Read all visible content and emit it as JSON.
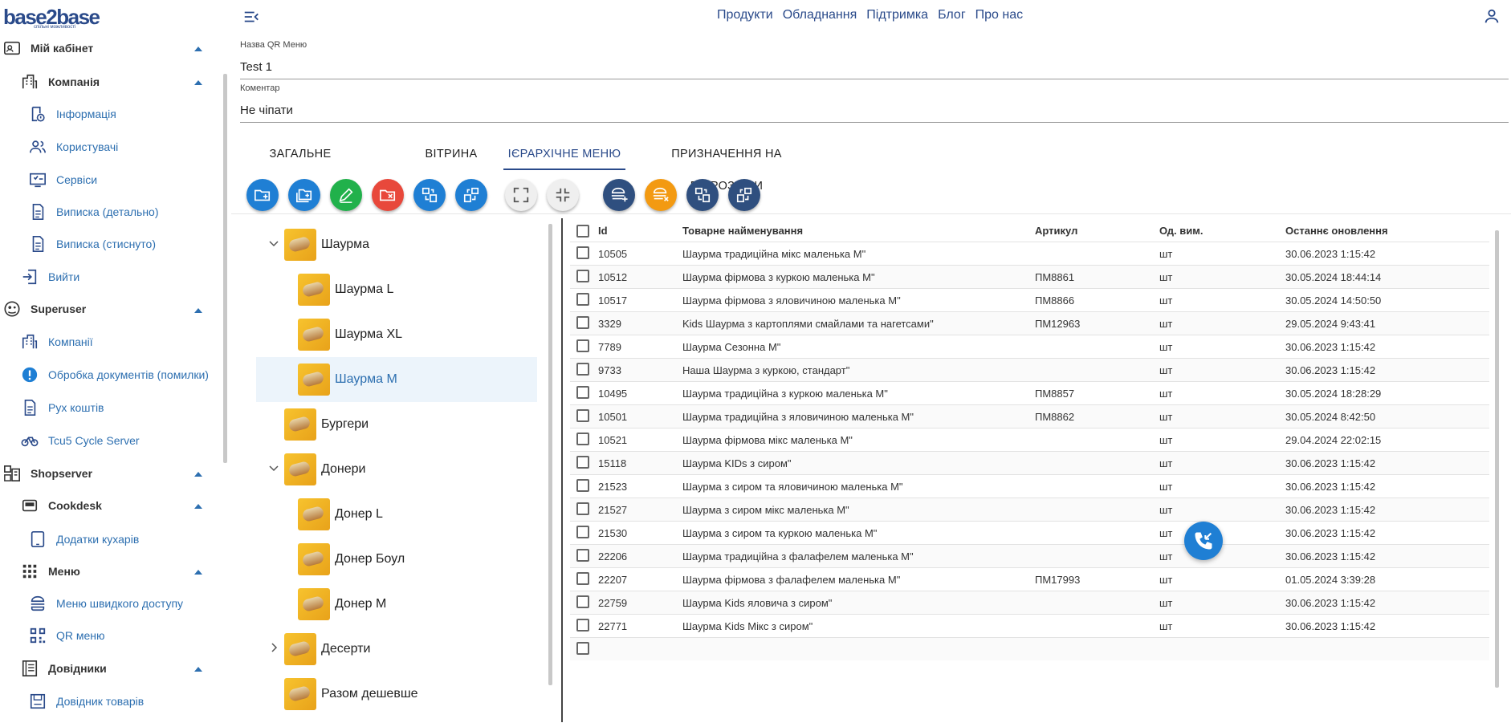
{
  "logo": {
    "text": "base2base",
    "tagline": "спільні можливості"
  },
  "topnav": [
    "Продукти",
    "Обладнання",
    "Підтримка",
    "Блог",
    "Про нас"
  ],
  "sidebar": {
    "my_cabinet": "Мій кабінет",
    "company": "Компанія",
    "company_items": [
      "Інформація",
      "Користувачі",
      "Сервіси",
      "Виписка (детально)",
      "Виписка (стиснуто)"
    ],
    "logout": "Вийти",
    "superuser": "Superuser",
    "superuser_items": [
      "Компанії",
      "Обробка документів (помилки)",
      "Рух коштів",
      "Tcu5 Cycle Server"
    ],
    "shopserver": "Shopserver",
    "cookdesk": "Cookdesk",
    "cookdesk_items": [
      "Додатки кухарів"
    ],
    "menu": "Меню",
    "menu_items": [
      "Меню швидкого доступу",
      "QR меню"
    ],
    "refs": "Довідники",
    "refs_items": [
      "Довідник товарів"
    ]
  },
  "form": {
    "name_label": "Назва QR Меню",
    "name_value": "Test 1",
    "comment_label": "Коментар",
    "comment_value": "Не чіпати"
  },
  "tabs": [
    "ЗАГАЛЬНЕ",
    "ВІТРИНА",
    "ІЄРАРХІЧНЕ МЕНЮ",
    "ПРИЗНАЧЕННЯ НА ПІДРОЗДІЛИ"
  ],
  "active_tab": "ІЄРАРХІЧНЕ МЕНЮ",
  "colors": {
    "primary": "#2a4a8a",
    "blue_btn": "#1f7fd4",
    "green_btn": "#21b14b",
    "red_btn": "#e8483b",
    "orange_btn": "#f39a12",
    "dark_btn": "#2f4f7f",
    "gray_btn": "#efefef"
  },
  "tree": {
    "nodes": [
      "Шаурма",
      "Шаурма L",
      "Шаурма XL",
      "Шаурма M",
      "Бургери",
      "Донери",
      "Донер L",
      "Донер Боул",
      "Донер M",
      "Десерти",
      "Разом дешевше"
    ],
    "selected": "Шаурма M"
  },
  "grid": {
    "headers": [
      "Id",
      "Товарне найменування",
      "Артикул",
      "Од. вим.",
      "Останнє оновлення"
    ],
    "rows": [
      [
        "10505",
        "Шаурма традиційна мікс маленька М\"",
        "",
        "шт",
        "30.06.2023 1:15:42"
      ],
      [
        "10512",
        "Шаурма фірмова з куркою маленька М\"",
        "ПМ8861",
        "шт",
        "30.05.2024 18:44:14"
      ],
      [
        "10517",
        "Шаурма фірмова з яловичиною маленька М\"",
        "ПМ8866",
        "шт",
        "30.05.2024 14:50:50"
      ],
      [
        "3329",
        "Kids Шаурма з картоплями смайлами та нагетсами\"",
        "ПМ12963",
        "шт",
        "29.05.2024 9:43:41"
      ],
      [
        "7789",
        "Шаурма Сезонна М\"",
        "",
        "шт",
        "30.06.2023 1:15:42"
      ],
      [
        "9733",
        "Наша Шаурма з куркою, стандарт\"",
        "",
        "шт",
        "30.06.2023 1:15:42"
      ],
      [
        "10495",
        "Шаурма традиційна з куркою маленька М\"",
        "ПМ8857",
        "шт",
        "30.05.2024 18:28:29"
      ],
      [
        "10501",
        "Шаурма традиційна з яловичиною маленька М\"",
        "ПМ8862",
        "шт",
        "30.05.2024 8:42:50"
      ],
      [
        "10521",
        "Шаурма фірмова мікс маленька М\"",
        "",
        "шт",
        "29.04.2024 22:02:15"
      ],
      [
        "15118",
        "Шаурма KIDs з сиром\"",
        "",
        "шт",
        "30.06.2023 1:15:42"
      ],
      [
        "21523",
        "Шаурма з сиром та яловичиною маленька М\"",
        "",
        "шт",
        "30.06.2023 1:15:42"
      ],
      [
        "21527",
        "Шаурма з сиром мікс маленька М\"",
        "",
        "шт",
        "30.06.2023 1:15:42"
      ],
      [
        "21530",
        "Шаурма з сиром та куркою маленька М\"",
        "",
        "шт",
        "30.06.2023 1:15:42"
      ],
      [
        "22206",
        "Шаурма традиційна з фалафелем маленька М\"",
        "",
        "шт",
        "30.06.2023 1:15:42"
      ],
      [
        "22207",
        "Шаурма фірмова з фалафелем маленька М\"",
        "ПМ17993",
        "шт",
        "01.05.2024 3:39:28"
      ],
      [
        "22759",
        "Шаурма Kids яловича з сиром\"",
        "",
        "шт",
        "30.06.2023 1:15:42"
      ],
      [
        "22771",
        "Шаурма Kids Мікс з сиром\"",
        "",
        "шт",
        "30.06.2023 1:15:42"
      ]
    ]
  }
}
